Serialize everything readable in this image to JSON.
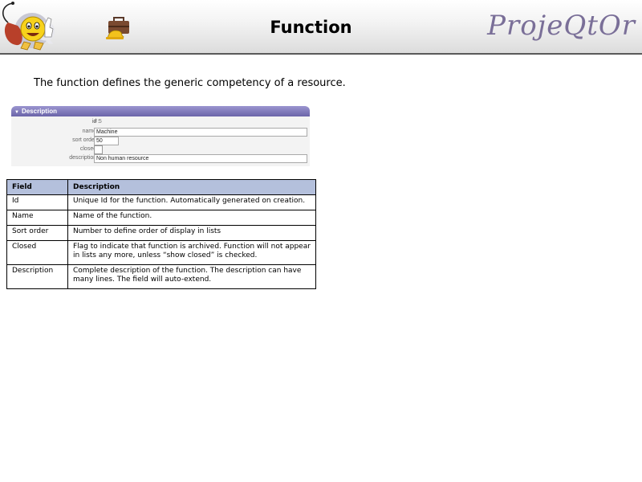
{
  "header": {
    "title": "Function",
    "brand": "ProjeQtOr",
    "logo_icon": "projeqtor-mascot-icon",
    "page_icon": "function-briefcase-icon"
  },
  "intro": "The function defines the generic competency of a resource.",
  "form": {
    "section_title": "Description",
    "fields": [
      {
        "label": "id :",
        "value": "# 5",
        "kind": "static"
      },
      {
        "label": "name :",
        "value": "Machine",
        "kind": "text"
      },
      {
        "label": "sort order :",
        "value": "50",
        "kind": "text"
      },
      {
        "label": "closed :",
        "value": "",
        "kind": "checkbox"
      },
      {
        "label": "description :",
        "value": "Non human resource",
        "kind": "text"
      }
    ]
  },
  "table": {
    "headers": [
      "Field",
      "Description"
    ],
    "rows": [
      {
        "field": "Id",
        "description": "Unique Id for the function. Automatically generated on creation."
      },
      {
        "field": "Name",
        "description": "Name of the function."
      },
      {
        "field": "Sort order",
        "description": "Number to define order of display in lists"
      },
      {
        "field": "Closed",
        "description": "Flag to indicate that function is archived. Function will not appear in lists any more, unless “show closed” is checked."
      },
      {
        "field": "Description",
        "description": "Complete description of the function. The description can have many lines. The field will auto-extend."
      }
    ]
  },
  "colors": {
    "brand": "#7a6f98",
    "panel_header": "#7a74b8",
    "table_header": "#b4c0dc"
  }
}
